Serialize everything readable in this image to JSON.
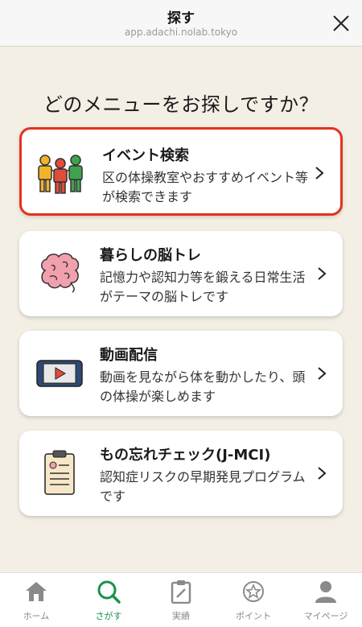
{
  "header": {
    "title": "探す",
    "url": "app.adachi.nolab.tokyo"
  },
  "question": "どのメニューをお探しですか？",
  "cards": [
    {
      "title": "イベント検索",
      "description": "区の体操教室やおすすめイベント等が検索できます",
      "icon": "people-group-icon",
      "highlighted": true
    },
    {
      "title": "暮らしの脳トレ",
      "description": "記憶力や認知力等を鍛える日常生活がテーマの脳トレです",
      "icon": "brain-icon",
      "highlighted": false
    },
    {
      "title": "動画配信",
      "description": "動画を見ながら体を動かしたり、頭の体操が楽しめます",
      "icon": "video-play-icon",
      "highlighted": false
    },
    {
      "title": "もの忘れチェック(J-MCI)",
      "description": "認知症リスクの早期発見プログラムです",
      "icon": "clipboard-checklist-icon",
      "highlighted": false
    }
  ],
  "nav": {
    "active": "さがす",
    "items": [
      {
        "label": "ホーム",
        "icon": "home-icon"
      },
      {
        "label": "さがす",
        "icon": "search-icon"
      },
      {
        "label": "実績",
        "icon": "clipboard-edit-icon"
      },
      {
        "label": "ポイント",
        "icon": "star-coin-icon"
      },
      {
        "label": "マイページ",
        "icon": "user-icon"
      }
    ]
  },
  "colors": {
    "background": "#f3efe4",
    "highlight_border": "#e3321f",
    "active_nav": "#19924b"
  }
}
